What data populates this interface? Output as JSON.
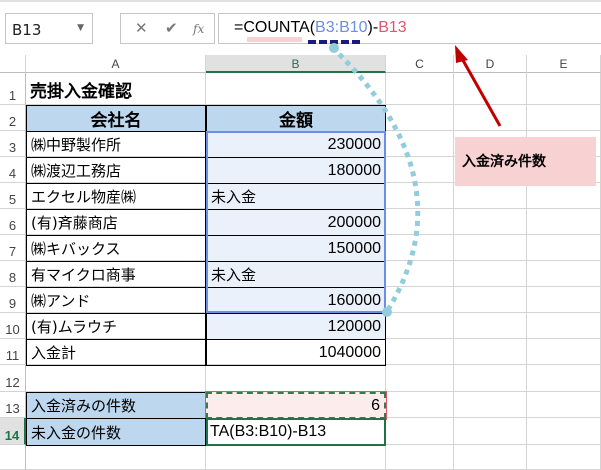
{
  "namebox": {
    "value": "B13"
  },
  "toolbar": {
    "cancel": "✕",
    "enter": "✔",
    "fx": "fx"
  },
  "formula": {
    "prefix": "=COUNTA(",
    "ref1": "B3:B10",
    "mid": ")-",
    "ref2": "B13"
  },
  "columns": [
    "A",
    "B",
    "C",
    "D",
    "E"
  ],
  "rows": [
    "1",
    "2",
    "3",
    "4",
    "5",
    "6",
    "7",
    "8",
    "9",
    "10",
    "11",
    "12",
    "13",
    "14"
  ],
  "sheet": {
    "title": "売掛入金確認",
    "headers": [
      "会社名",
      "金額"
    ],
    "data": [
      {
        "name": "㈱中野製作所",
        "amount": "230000"
      },
      {
        "name": "㈱渡辺工務店",
        "amount": "180000"
      },
      {
        "name": "エクセル物産㈱",
        "amount": "未入金"
      },
      {
        "name": "(有)斉藤商店",
        "amount": "200000"
      },
      {
        "name": "㈱キバックス",
        "amount": "150000"
      },
      {
        "name": "有マイクロ商事",
        "amount": "未入金"
      },
      {
        "name": "㈱アンド",
        "amount": "160000"
      },
      {
        "name": "(有)ムラウチ",
        "amount": "120000"
      }
    ],
    "total_label": "入金計",
    "total": "1040000",
    "paid_label": "入金済みの件数",
    "paid": "6",
    "unpaid_label": "未入金の件数",
    "unpaid_edit": "TA(B3:B10)-B13"
  },
  "callout": {
    "text": "入金済み件数"
  },
  "colors": {
    "ref1": "#6b8ee8",
    "ref2": "#e0576b",
    "header_fill": "#bdd7ee",
    "callout_fill": "#f8d1d3",
    "arrow": "#c00000",
    "dotted": "#92cddc"
  }
}
